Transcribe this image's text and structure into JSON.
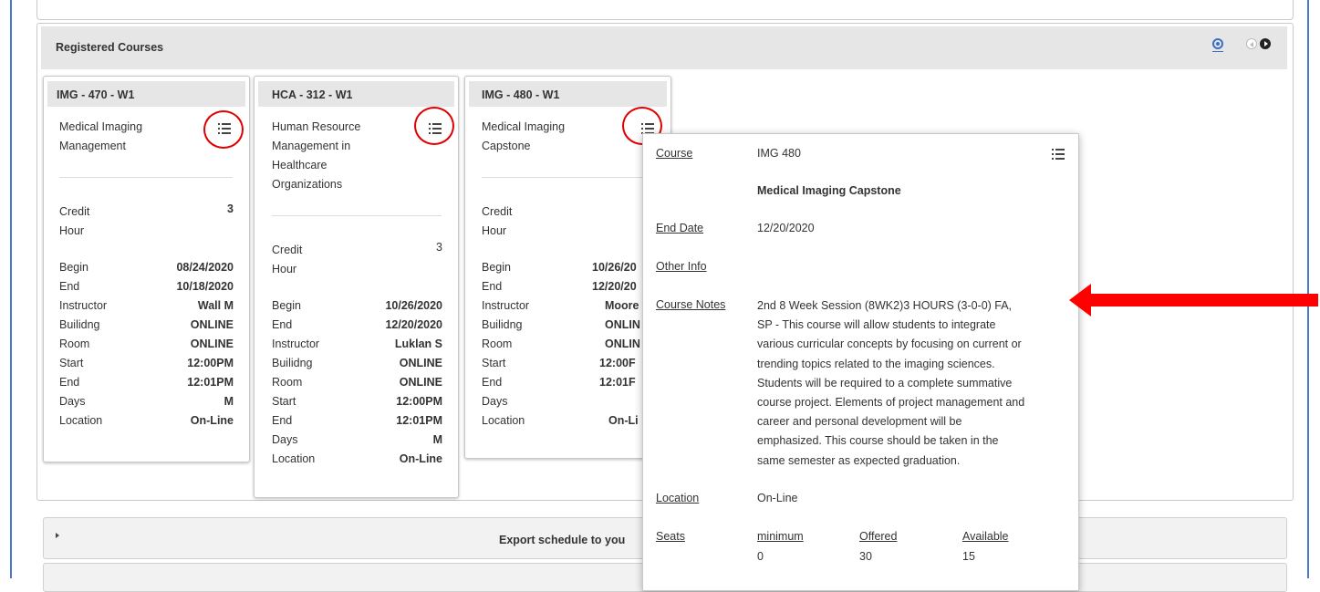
{
  "panel": {
    "title": "Registered Courses"
  },
  "labels": {
    "credit_hour": [
      "Credit",
      "Hour"
    ],
    "begin": "Begin",
    "end": "End",
    "instructor": "Instructor",
    "building": "Builidng",
    "room": "Room",
    "start": "Start",
    "end_time": "End",
    "days": "Days",
    "location": "Location"
  },
  "courses": [
    {
      "code": "IMG - 470 - W1",
      "title": [
        "Medical Imaging",
        "Management"
      ],
      "credit": "3",
      "begin": "08/24/2020",
      "end": "10/18/2020",
      "instructor": "Wall M",
      "building": "ONLINE",
      "room": "ONLINE",
      "start": "12:00PM",
      "end_time": "12:01PM",
      "days": "M",
      "location": "On-Line"
    },
    {
      "code": "HCA - 312 - W1",
      "title": [
        "Human Resource",
        "Management in",
        "Healthcare",
        "Organizations"
      ],
      "credit": "3",
      "begin": "10/26/2020",
      "end": "12/20/2020",
      "instructor": "Luklan S",
      "building": "ONLINE",
      "room": "ONLINE",
      "start": "12:00PM",
      "end_time": "12:01PM",
      "days": "M",
      "location": "On-Line"
    },
    {
      "code": "IMG - 480 - W1",
      "title": [
        "Medical Imaging",
        "Capstone"
      ],
      "credit": "",
      "begin": "10/26/20",
      "end": "12/20/20",
      "instructor": "Moore",
      "building": "ONLIN",
      "room": "ONLIN",
      "start": "12:00F",
      "end_time": "12:01F",
      "days": "",
      "location": "On-Li"
    }
  ],
  "popup": {
    "course_label": "Course",
    "course_value": "IMG 480",
    "course_name": "Medical Imaging Capstone",
    "end_date_label": "End Date",
    "end_date_value": "12/20/2020",
    "other_info_label": "Other Info",
    "notes_label": "Course Notes",
    "notes_lines": [
      "2nd 8 Week Session (8WK2)3 HOURS (3-0-0) FA,",
      "SP - This course will allow students to integrate",
      "various curricular concepts by focusing on current or",
      "trending topics related to the imaging sciences.",
      "Students will be required to a complete summative",
      "course project. Elements of project management and",
      "career and personal development will be",
      "emphasized. This course should be taken in the",
      "same semester as expected graduation."
    ],
    "location_label": "Location",
    "location_value": "On-Line",
    "seats_label": "Seats",
    "seats": {
      "minimum_label": "minimum",
      "offered_label": "Offered",
      "available_label": "Available",
      "minimum": "0",
      "offered": "30",
      "available": "15"
    }
  },
  "export": {
    "label": "Export schedule to you"
  },
  "colors": {
    "annotation": "#ff0000",
    "accent_blue": "#4a78c9",
    "header_bg": "#e6e6e6"
  }
}
